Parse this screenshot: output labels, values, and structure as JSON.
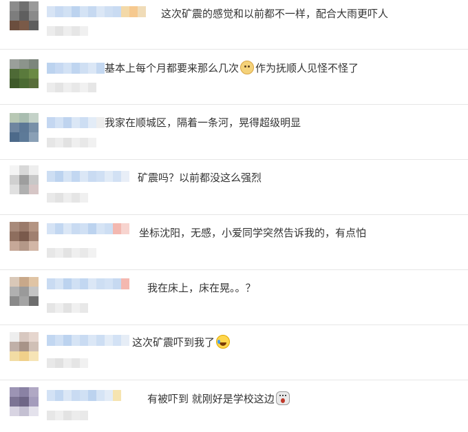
{
  "comments": [
    {
      "text_before": "这次矿震的感觉和以前都不一样，配合大雨更吓人",
      "emoji": "",
      "text_after": ""
    },
    {
      "text_before": "基本上每个月都要来那么几次",
      "emoji": "doge-icon",
      "text_after": "作为抚顺人见怪不怪了"
    },
    {
      "text_before": "我家在顺城区，隔着一条河，晃得超级明显",
      "emoji": "",
      "text_after": ""
    },
    {
      "text_before": "矿震吗？以前都没这么强烈",
      "emoji": "",
      "text_after": ""
    },
    {
      "text_before": "坐标沈阳，无感，小爱同学突然告诉我的，有点怕",
      "emoji": "",
      "text_after": ""
    },
    {
      "text_before": "我在床上，床在晃。。？",
      "emoji": "",
      "text_after": ""
    },
    {
      "text_before": "这次矿震吓到我了",
      "emoji": "laugh-cry-icon",
      "text_after": ""
    },
    {
      "text_before": "有被吓到 就刚好是学校这边",
      "emoji": "shocked-face-icon",
      "text_after": ""
    }
  ],
  "colors": {
    "text": "#333333",
    "divider": "#e6e6e6",
    "username_blur": "#cfe0f3"
  }
}
